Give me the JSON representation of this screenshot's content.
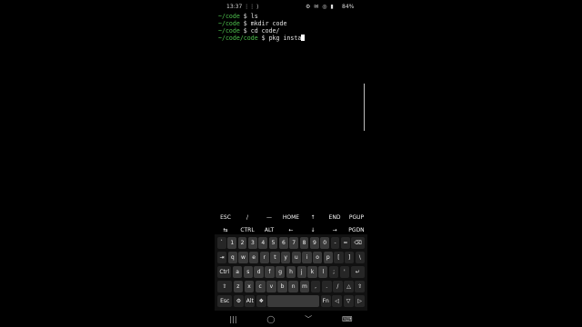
{
  "status_bar": {
    "time": "13:37",
    "time_extra": "⋮⋮ ⟩",
    "icons": "⚙ ✉ ◎ ▮",
    "battery": "84%"
  },
  "terminal": {
    "lines": [
      {
        "path": "~/code",
        "cmd": " $ ls"
      },
      {
        "path": "~/code",
        "cmd": " $ mkdir code"
      },
      {
        "path": "~/code",
        "cmd": " $ cd code/"
      },
      {
        "path": "~/code/code",
        "cmd": " $ pkg insta"
      }
    ]
  },
  "extra_keys": {
    "row1": [
      "ESC",
      "/",
      "—",
      "HOME",
      "↑",
      "END",
      "PGUP"
    ],
    "row2": [
      "⇆",
      "CTRL",
      "ALT",
      "←",
      "↓",
      "→",
      "PGDN"
    ]
  },
  "keyboard": {
    "row_numbers": [
      "`",
      "1",
      "2",
      "3",
      "4",
      "5",
      "6",
      "7",
      "8",
      "9",
      "0",
      "-",
      "=",
      "⌫"
    ],
    "row_top": [
      "⇥",
      "q",
      "w",
      "e",
      "r",
      "t",
      "y",
      "u",
      "i",
      "o",
      "p",
      "[",
      "]",
      "\\"
    ],
    "row_home": [
      "Ctrl",
      "a",
      "s",
      "d",
      "f",
      "g",
      "h",
      "j",
      "k",
      "l",
      ";",
      "'",
      "↵"
    ],
    "row_bottom": [
      "⇧",
      "z",
      "x",
      "c",
      "v",
      "b",
      "n",
      "m",
      ",",
      ".",
      "/",
      "△",
      "⇧"
    ],
    "row_space": [
      "Esc",
      "⚙",
      "Alt",
      "❖",
      "",
      "Fn",
      "◁",
      "▽",
      "▷"
    ]
  },
  "nav_bar": {
    "recents": "|||",
    "home": "◯",
    "back": "﹀",
    "keyboard": "⌨"
  }
}
